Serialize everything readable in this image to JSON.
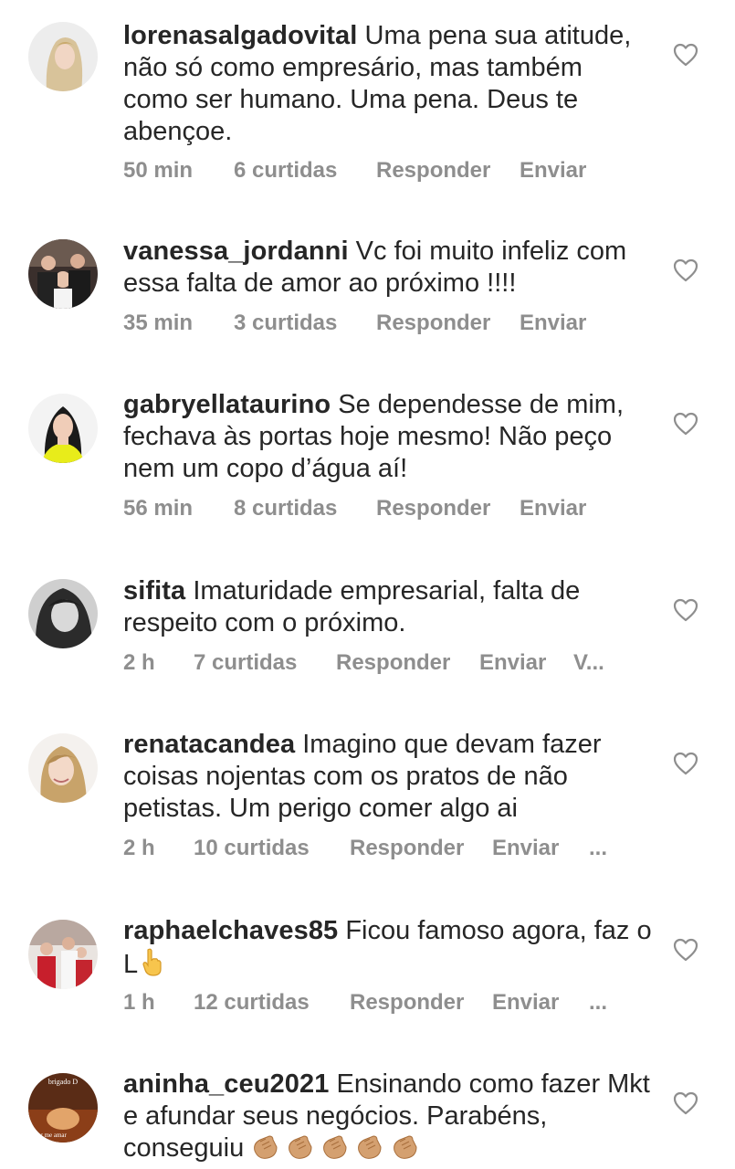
{
  "comments": [
    {
      "username": "lorenasalgadovital",
      "text": " Uma pena sua atitude, não só como empresário, mas também como ser humano. Uma pena. Deus te abençoe.",
      "time": "50 min",
      "likes": "6 curtidas",
      "reply": "Responder",
      "send": "Enviar",
      "extra": ""
    },
    {
      "username": "vanessa_jordanni",
      "text": " Vc foi muito infeliz com essa falta de amor ao próximo !!!!",
      "time": "35 min",
      "likes": "3 curtidas",
      "reply": "Responder",
      "send": "Enviar",
      "extra": ""
    },
    {
      "username": "gabryellataurino",
      "text": " Se dependesse de mim, fechava às portas hoje mesmo! Não peço nem um copo d’água aí!",
      "time": "56 min",
      "likes": "8 curtidas",
      "reply": "Responder",
      "send": "Enviar",
      "extra": ""
    },
    {
      "username": "sifita",
      "text": " Imaturidade empresarial, falta de respeito com o próximo.",
      "time": "2 h",
      "likes": "7 curtidas",
      "reply": "Responder",
      "send": "Enviar",
      "extra": "V..."
    },
    {
      "username": "renatacandea",
      "text": " Imagino que devam fazer coisas nojentas com os pratos de não petistas. Um perigo comer algo ai",
      "time": "2 h",
      "likes": "10 curtidas",
      "reply": "Responder",
      "send": "Enviar",
      "extra": "..."
    },
    {
      "username": "raphaelchaves85",
      "text": " Ficou famoso agora, faz o L",
      "time": "1 h",
      "likes": "12 curtidas",
      "reply": "Responder",
      "send": "Enviar",
      "extra": "...",
      "emoji": "pointing-up-hand-emoji"
    },
    {
      "username": "aninha_ceu2021",
      "text": " Ensinando como fazer Mkt e afundar seus negócios. Parabéns, conseguiu",
      "emoji": "clapping-hands-emoji x5",
      "avatar_caption_top": "brigado D",
      "avatar_caption_bottom": "Por me amar"
    }
  ],
  "colors": {
    "text": "#262626",
    "meta": "#8e8e8e",
    "heart_stroke": "#8e8e8e",
    "background": "#ffffff"
  },
  "icons": {
    "like": "heart-outline-icon"
  }
}
